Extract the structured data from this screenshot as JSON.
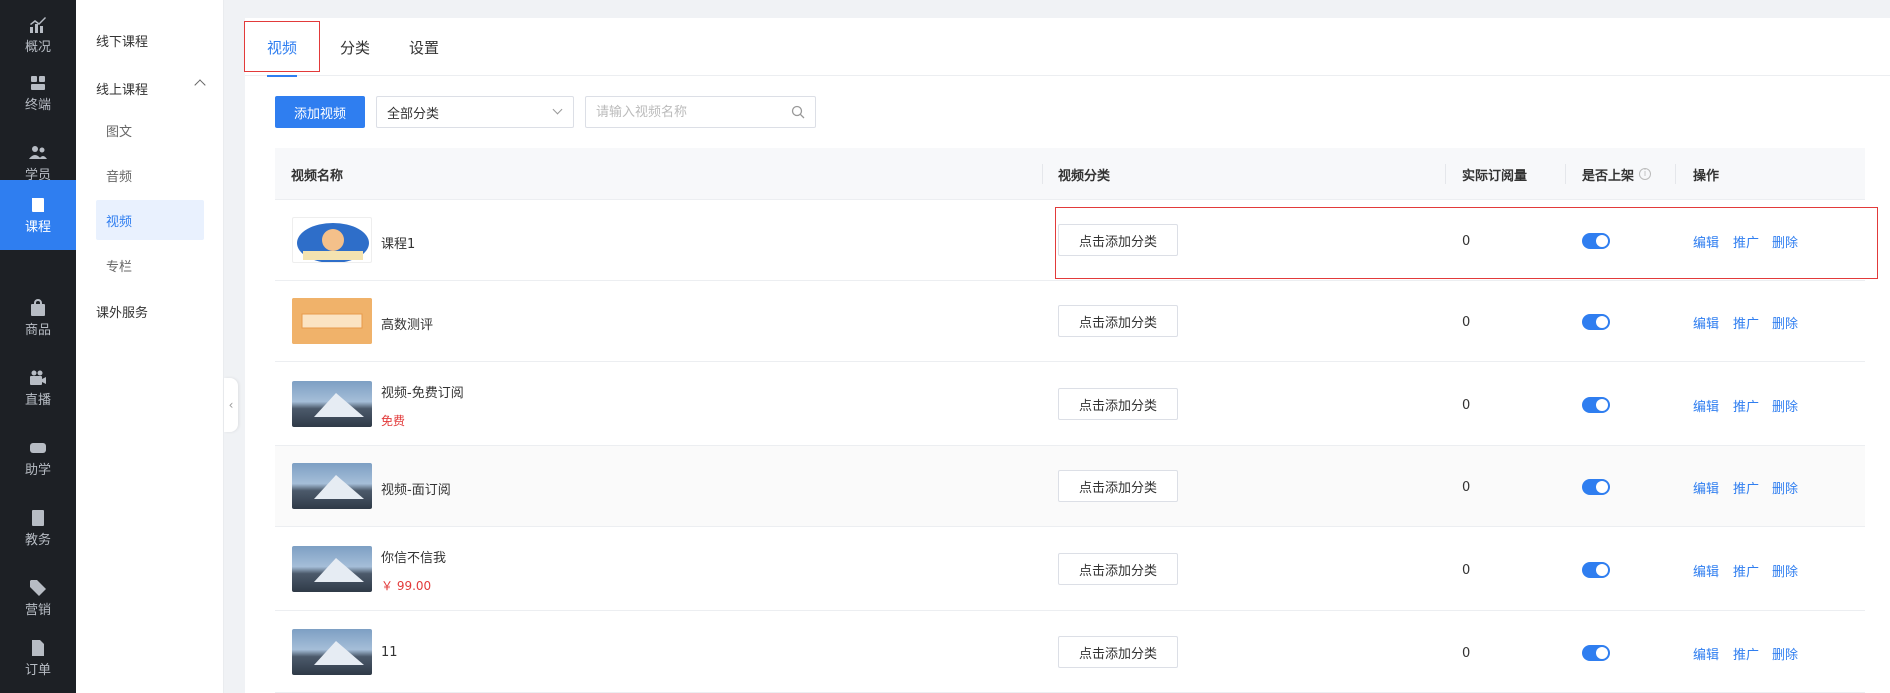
{
  "rail": {
    "items": [
      {
        "label": "概况",
        "icon": "chart-icon"
      },
      {
        "label": "终端",
        "icon": "store-icon"
      },
      {
        "label": "学员",
        "icon": "users-icon"
      },
      {
        "label": "课程",
        "icon": "book-icon",
        "active": true
      },
      {
        "label": "商品",
        "icon": "bag-icon"
      },
      {
        "label": "直播",
        "icon": "video-camera-icon"
      },
      {
        "label": "助学",
        "icon": "gamepad-icon"
      },
      {
        "label": "教务",
        "icon": "notebook-icon"
      },
      {
        "label": "营销",
        "icon": "tag-icon"
      },
      {
        "label": "订单",
        "icon": "document-icon"
      }
    ]
  },
  "submenu": {
    "items": [
      {
        "label": "线下课程"
      },
      {
        "label": "线上课程"
      },
      {
        "label": "图文"
      },
      {
        "label": "音频"
      },
      {
        "label": "视频"
      },
      {
        "label": "专栏"
      },
      {
        "label": "课外服务"
      }
    ]
  },
  "tabs": [
    {
      "label": "视频",
      "active": true
    },
    {
      "label": "分类"
    },
    {
      "label": "设置"
    }
  ],
  "toolbar": {
    "add_label": "添加视频",
    "category_select": "全部分类",
    "search_placeholder": "请输入视频名称"
  },
  "table": {
    "headers": [
      "视频名称",
      "视频分类",
      "实际订阅量",
      "是否上架",
      "操作"
    ],
    "category_button": "点击添加分类",
    "ops": [
      "编辑",
      "推广",
      "删除"
    ],
    "rows": [
      {
        "name": "课程1",
        "price": "",
        "subscribers": "0",
        "on_shelf": true,
        "thumb": "cartoon"
      },
      {
        "name": "高数测评",
        "price": "",
        "subscribers": "0",
        "on_shelf": true,
        "thumb": "orange"
      },
      {
        "name": "视频-免费订阅",
        "price": "免费",
        "subscribers": "0",
        "on_shelf": true,
        "thumb": "mountain"
      },
      {
        "name": "视频-面订阅",
        "price": "",
        "subscribers": "0",
        "on_shelf": true,
        "thumb": "mountain"
      },
      {
        "name": "你信不信我",
        "price": "￥ 99.00",
        "subscribers": "0",
        "on_shelf": true,
        "thumb": "mountain"
      },
      {
        "name": "11",
        "price": "",
        "subscribers": "0",
        "on_shelf": true,
        "thumb": "mountain"
      }
    ]
  },
  "colors": {
    "accent": "#2f7ef0",
    "rail_bg": "#1d2025",
    "highlight_red": "#e23a3a",
    "price_red": "#e23a3a"
  }
}
